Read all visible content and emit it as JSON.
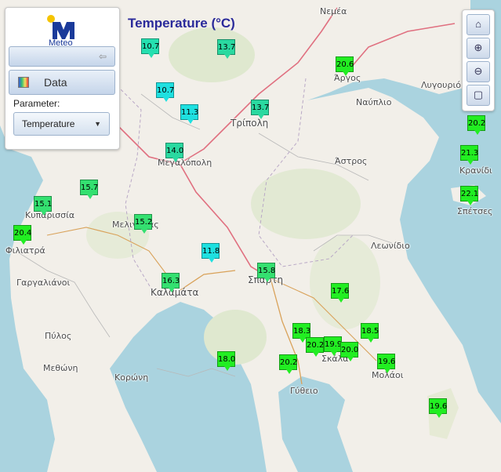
{
  "map_title": "Temperature (°C)",
  "panel": {
    "logo_text": "Meteo",
    "data_label": "Data",
    "parameter_label": "Parameter:",
    "parameter_value": "Temperature"
  },
  "zoom_controls": {
    "home_icon": "home-icon",
    "zoom_in_icon": "zoom-in-icon",
    "zoom_out_icon": "zoom-out-icon",
    "fullscreen_icon": "fullscreen-icon"
  },
  "places": [
    "Νεμέα",
    "Άργος",
    "Ναύπλιο",
    "Λυγουριό",
    "Τρίπολη",
    "Άστρος",
    "Μεγαλόπολη",
    "Κρανίδι",
    "Σπέτσες",
    "Κυπαρισσία",
    "Μελιγαλάς",
    "Φιλιατρά",
    "Λεωνίδιο",
    "Γαργαλιάνοι",
    "Καλαμάτα",
    "Σπάρτη",
    "Πύλος",
    "Σκάλα",
    "Μεθώνη",
    "Κορώνη",
    "Μολάοι",
    "Γύθειο"
  ],
  "station_values": [
    "10.7",
    "13.7",
    "20.6",
    "10.7",
    "11.3",
    "13.7",
    "20.2",
    "14.0",
    "21.3",
    "15.7",
    "22.1",
    "15.1",
    "15.2",
    "20.4",
    "11.8",
    "15.8",
    "16.3",
    "17.6",
    "18.3",
    "20.2",
    "19.9",
    "20.0",
    "18.5",
    "19.6",
    "18.0",
    "20.2",
    "19.6"
  ],
  "colors": {
    "cool": "#1ee0e0",
    "mild": "#23e2a8",
    "warm": "#22ee22",
    "sea": "#aad3df",
    "land": "#f2efe9",
    "road_major": "#e07080",
    "title": "#2a2a9a"
  }
}
